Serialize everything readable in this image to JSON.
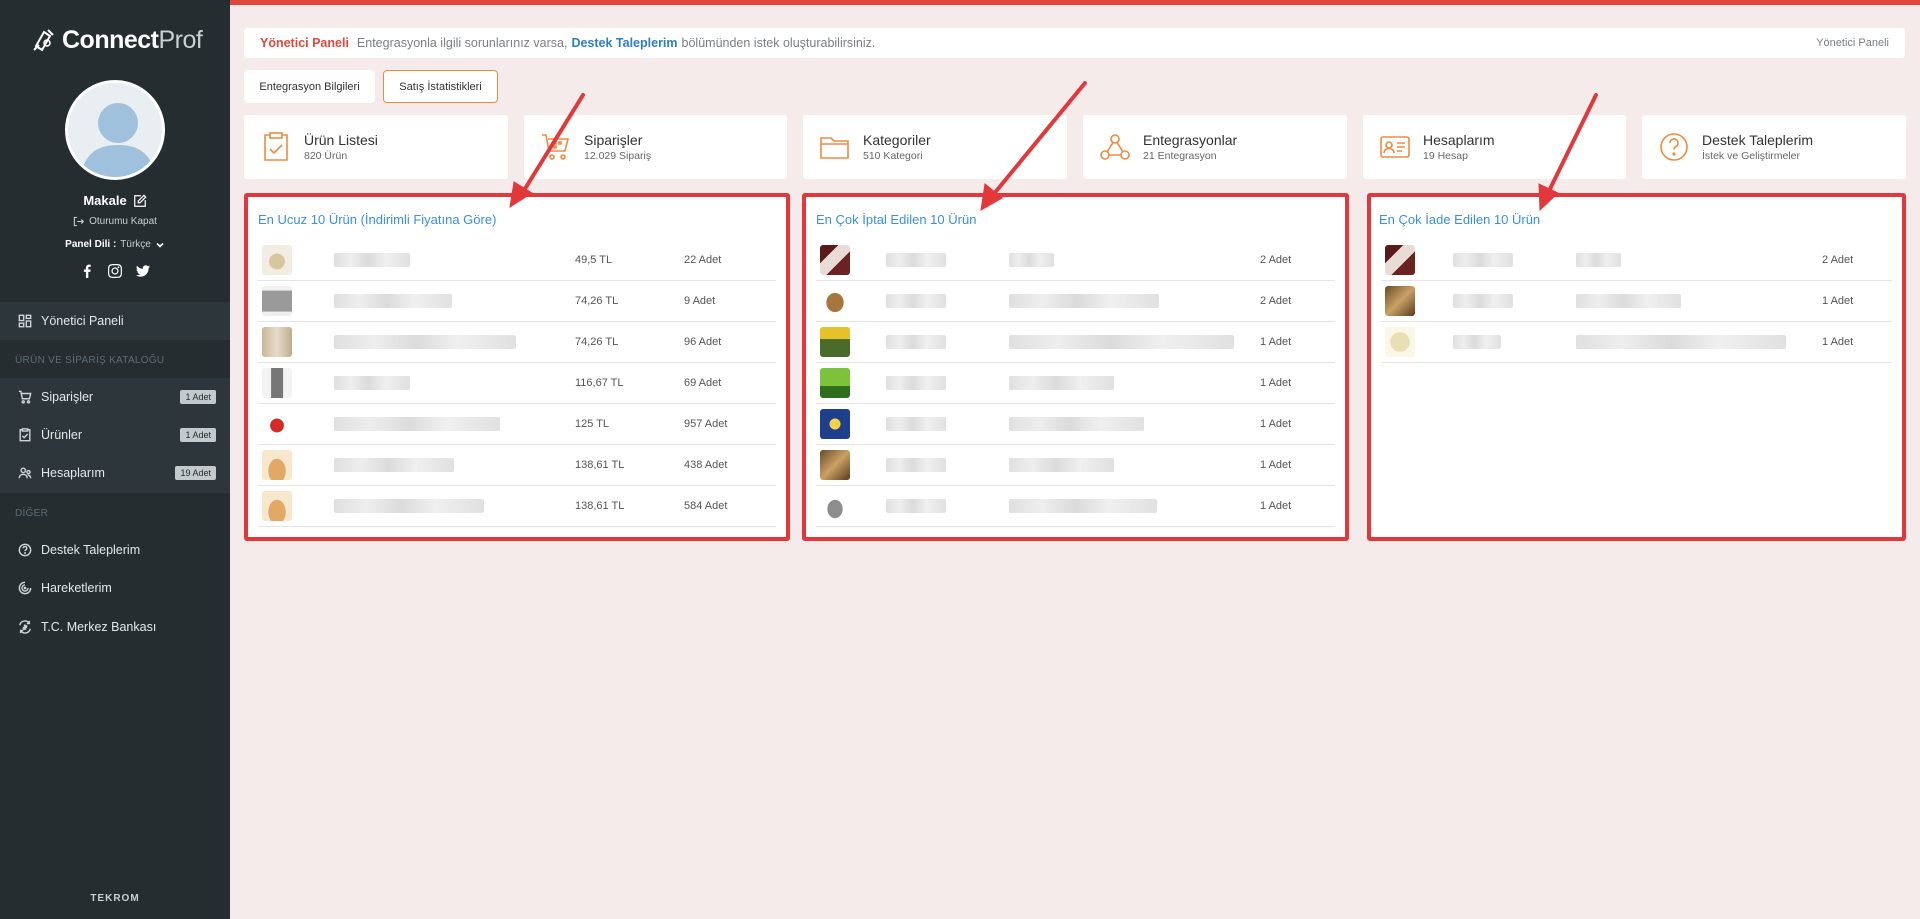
{
  "sidebar": {
    "brand_bold": "Connect",
    "brand_light": "Prof",
    "user_name": "Makale",
    "logout": "Oturumu Kapat",
    "lang_label": "Panel Dili :",
    "lang_value": "Türkçe",
    "dashboard": "Yönetici Paneli",
    "section_catalog": "ÜRÜN VE SİPARİŞ KATALOĞU",
    "orders": "Siparişler",
    "orders_badge": "1 Adet",
    "products": "Ürünler",
    "products_badge": "1 Adet",
    "accounts": "Hesaplarım",
    "accounts_badge": "19 Adet",
    "section_other": "DİĞER",
    "support": "Destek Taleplerim",
    "activity": "Hareketlerim",
    "central_bank": "T.C. Merkez Bankası",
    "footer": "TEKROM"
  },
  "breadcrumb": {
    "title": "Yönetici Paneli",
    "text_before": "Entegrasyonla ilgili sorunlarınız varsa,",
    "link": "Destek Taleplerim",
    "text_after": "bölümünden istek oluşturabilirsiniz.",
    "right": "Yönetici Paneli"
  },
  "tabs": {
    "integration_info": "Entegrasyon Bilgileri",
    "sales_stats": "Satış İstatistikleri"
  },
  "cards": [
    {
      "title": "Ürün Listesi",
      "sub": "820 Ürün",
      "icon": "clipboard-check-icon"
    },
    {
      "title": "Siparişler",
      "sub": "12.029 Sipariş",
      "icon": "cart-icon"
    },
    {
      "title": "Kategoriler",
      "sub": "510 Kategori",
      "icon": "folder-icon"
    },
    {
      "title": "Entegrasyonlar",
      "sub": "21 Entegrasyon",
      "icon": "webhook-icon"
    },
    {
      "title": "Hesaplarım",
      "sub": "19 Hesap",
      "icon": "id-card-icon"
    },
    {
      "title": "Destek Taleplerim",
      "sub": "İstek ve Geliştirmeler",
      "icon": "help-circle-icon"
    }
  ],
  "cheapest": {
    "title": "En Ucuz 10 Ürün (İndirimli Fiyatına Göre)",
    "rows": [
      {
        "price": "49,5 TL",
        "qty": "22 Adet"
      },
      {
        "price": "74,26 TL",
        "qty": "9 Adet"
      },
      {
        "price": "74,26 TL",
        "qty": "96 Adet"
      },
      {
        "price": "116,67 TL",
        "qty": "69 Adet"
      },
      {
        "price": "125 TL",
        "qty": "957 Adet"
      },
      {
        "price": "138,61 TL",
        "qty": "438 Adet"
      },
      {
        "price": "138,61 TL",
        "qty": "584 Adet"
      }
    ]
  },
  "cancelled": {
    "title": "En Çok İptal Edilen 10 Ürün",
    "rows": [
      {
        "qty": "2 Adet"
      },
      {
        "qty": "2 Adet"
      },
      {
        "qty": "1 Adet"
      },
      {
        "qty": "1 Adet"
      },
      {
        "qty": "1 Adet"
      },
      {
        "qty": "1 Adet"
      },
      {
        "qty": "1 Adet"
      }
    ]
  },
  "returned": {
    "title": "En Çok İade Edilen 10 Ürün",
    "rows": [
      {
        "qty": "2 Adet"
      },
      {
        "qty": "1 Adet"
      },
      {
        "qty": "1 Adet"
      }
    ]
  },
  "colors": {
    "accent": "#e2473c",
    "highlight": "#e2383b",
    "link": "#2c7ec8",
    "icon": "#f08a3e",
    "sidebar": "#252d31"
  }
}
